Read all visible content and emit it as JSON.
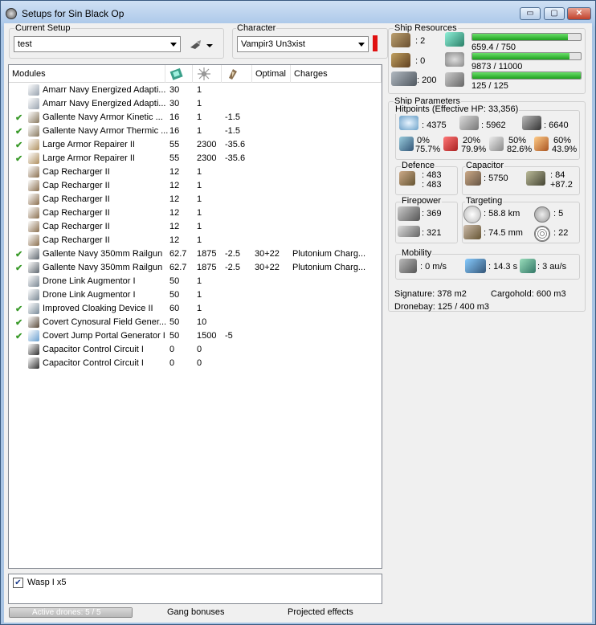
{
  "window": {
    "title": "Setups for Sin Black Op",
    "minimize": "▭",
    "maximize": "▢",
    "close": "✕"
  },
  "setup": {
    "label": "Current Setup",
    "value": "test"
  },
  "character": {
    "label": "Character",
    "value": "Vampir3 Un3xist",
    "status_color": "#e01010"
  },
  "modules": {
    "headers": [
      "Modules",
      "",
      "",
      "",
      "Optimal",
      "Charges"
    ],
    "header_icons": [
      "cpu-icon",
      "powergrid-icon",
      "capacitor-icon"
    ],
    "rows": [
      {
        "check": "",
        "name": "Amarr Navy Energized Adapti...",
        "cpu": "30",
        "pg": "1",
        "cap": "",
        "optimal": "",
        "charges": "",
        "icon": "#9aa4b0"
      },
      {
        "check": "",
        "name": "Amarr Navy Energized Adapti...",
        "cpu": "30",
        "pg": "1",
        "cap": "",
        "optimal": "",
        "charges": "",
        "icon": "#9aa4b0"
      },
      {
        "check": "✔",
        "name": "Gallente Navy Armor Kinetic ...",
        "cpu": "16",
        "pg": "1",
        "cap": "-1.5",
        "optimal": "",
        "charges": "",
        "icon": "#8a7a60"
      },
      {
        "check": "✔",
        "name": "Gallente Navy Armor Thermic ...",
        "cpu": "16",
        "pg": "1",
        "cap": "-1.5",
        "optimal": "",
        "charges": "",
        "icon": "#8a7a60"
      },
      {
        "check": "✔",
        "name": "Large Armor Repairer II",
        "cpu": "55",
        "pg": "2300",
        "cap": "-35.6",
        "optimal": "",
        "charges": "",
        "icon": "#b09060"
      },
      {
        "check": "✔",
        "name": "Large Armor Repairer II",
        "cpu": "55",
        "pg": "2300",
        "cap": "-35.6",
        "optimal": "",
        "charges": "",
        "icon": "#b09060"
      },
      {
        "check": "",
        "name": "Cap Recharger II",
        "cpu": "12",
        "pg": "1",
        "cap": "",
        "optimal": "",
        "charges": "",
        "icon": "#8c7050"
      },
      {
        "check": "",
        "name": "Cap Recharger II",
        "cpu": "12",
        "pg": "1",
        "cap": "",
        "optimal": "",
        "charges": "",
        "icon": "#8c7050"
      },
      {
        "check": "",
        "name": "Cap Recharger II",
        "cpu": "12",
        "pg": "1",
        "cap": "",
        "optimal": "",
        "charges": "",
        "icon": "#8c7050"
      },
      {
        "check": "",
        "name": "Cap Recharger II",
        "cpu": "12",
        "pg": "1",
        "cap": "",
        "optimal": "",
        "charges": "",
        "icon": "#8c7050"
      },
      {
        "check": "",
        "name": "Cap Recharger II",
        "cpu": "12",
        "pg": "1",
        "cap": "",
        "optimal": "",
        "charges": "",
        "icon": "#8c7050"
      },
      {
        "check": "",
        "name": "Cap Recharger II",
        "cpu": "12",
        "pg": "1",
        "cap": "",
        "optimal": "",
        "charges": "",
        "icon": "#8c7050"
      },
      {
        "check": "✔",
        "name": "Gallente Navy 350mm Railgun",
        "cpu": "62.7",
        "pg": "1875",
        "cap": "-2.5",
        "optimal": "30+22",
        "charges": "Plutonium Charg...",
        "icon": "#606870"
      },
      {
        "check": "✔",
        "name": "Gallente Navy 350mm Railgun",
        "cpu": "62.7",
        "pg": "1875",
        "cap": "-2.5",
        "optimal": "30+22",
        "charges": "Plutonium Charg...",
        "icon": "#606870"
      },
      {
        "check": "",
        "name": "Drone Link Augmentor I",
        "cpu": "50",
        "pg": "1",
        "cap": "",
        "optimal": "",
        "charges": "",
        "icon": "#7a8894"
      },
      {
        "check": "",
        "name": "Drone Link Augmentor I",
        "cpu": "50",
        "pg": "1",
        "cap": "",
        "optimal": "",
        "charges": "",
        "icon": "#7a8894"
      },
      {
        "check": "✔",
        "name": "Improved Cloaking Device II",
        "cpu": "60",
        "pg": "1",
        "cap": "",
        "optimal": "",
        "charges": "",
        "icon": "#7a8c9a"
      },
      {
        "check": "✔",
        "name": "Covert Cynosural Field Gener...",
        "cpu": "50",
        "pg": "10",
        "cap": "",
        "optimal": "",
        "charges": "",
        "icon": "#5a4a3a"
      },
      {
        "check": "✔",
        "name": "Covert Jump Portal Generator I",
        "cpu": "50",
        "pg": "1500",
        "cap": "-5",
        "optimal": "",
        "charges": "",
        "icon": "#6aa0d0"
      },
      {
        "check": "",
        "name": "Capacitor Control Circuit I",
        "cpu": "0",
        "pg": "0",
        "cap": "",
        "optimal": "",
        "charges": "",
        "icon": "#303030"
      },
      {
        "check": "",
        "name": "Capacitor Control Circuit I",
        "cpu": "0",
        "pg": "0",
        "cap": "",
        "optimal": "",
        "charges": "",
        "icon": "#303030"
      }
    ]
  },
  "drones": {
    "checked": "✔",
    "label": "Wasp I x5"
  },
  "bottom": {
    "active_drones": "Active drones: 5 / 5",
    "gang": "Gang bonuses",
    "projected": "Projected effects"
  },
  "resources": {
    "label": "Ship Resources",
    "turrets": ": 2",
    "launchers": ": 0",
    "bandwidth": ": 200",
    "cpu": "659.4 / 750",
    "cpu_fill": 0.879,
    "powergrid": "9873 / 11000",
    "powergrid_fill": 0.898,
    "dronebw": "125 / 125",
    "dronebw_fill": 1.0
  },
  "params": {
    "label": "Ship Parameters",
    "hitpoints": {
      "label": "Hitpoints (Effective HP: 33,356)",
      "shield": ": 4375",
      "armor": ": 5962",
      "hull": ": 6640",
      "r1a": "0%",
      "r1b": "75.7%",
      "r2a": "20%",
      "r2b": "79.9%",
      "r3a": "50%",
      "r3b": "82.6%",
      "r4a": "60%",
      "r4b": "43.9%"
    },
    "defence": {
      "label": "Defence",
      "v1": ": 483",
      "v2": ": 483"
    },
    "capacitor": {
      "label": "Capacitor",
      "amount": ": 5750",
      "v1": ": 84",
      "v2": "+87.2"
    },
    "firepower": {
      "label": "Firepower",
      "v1": ": 369",
      "v2": ": 321"
    },
    "targeting": {
      "label": "Targeting",
      "range": ": 58.8 km",
      "targets": ": 5",
      "scan": ": 74.5 mm",
      "sensor": ": 22"
    },
    "mobility": {
      "label": "Mobility",
      "speed": ": 0 m/s",
      "align": ": 14.3 s",
      "warp": ": 3 au/s"
    },
    "signature": "Signature: 378 m2",
    "cargo": "Cargohold: 600 m3",
    "dronebay": "Dronebay: 125 / 400 m3"
  }
}
